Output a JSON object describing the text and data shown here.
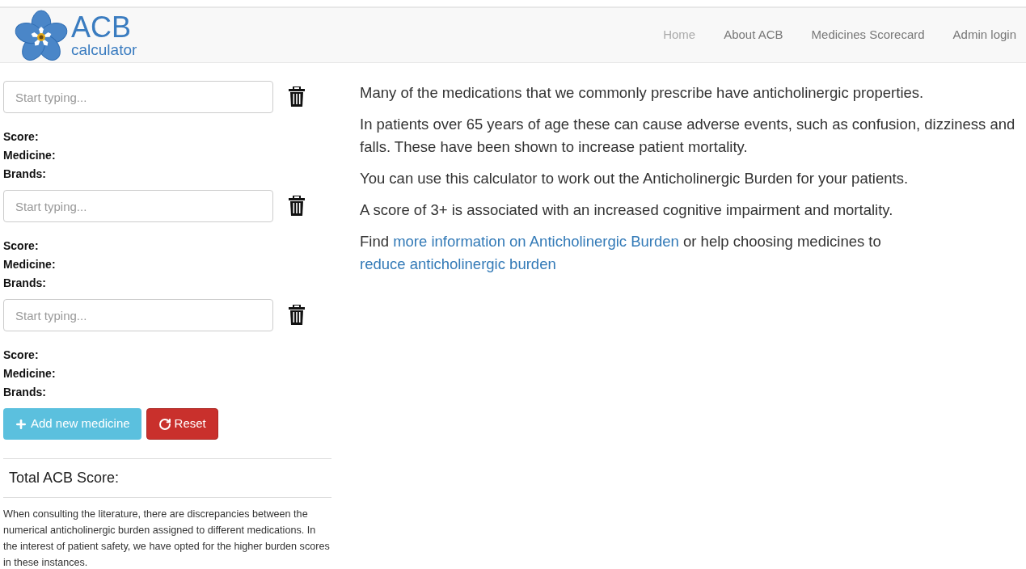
{
  "brand": {
    "title": "ACB",
    "subtitle": "calculator"
  },
  "nav": [
    {
      "label": "Home",
      "selected": true
    },
    {
      "label": "About ACB",
      "selected": false
    },
    {
      "label": "Medicines Scorecard",
      "selected": false
    },
    {
      "label": "Admin login",
      "selected": false
    }
  ],
  "medicines": [
    {
      "placeholder": "Start typing...",
      "fields": [
        "Score:",
        "Medicine:",
        "Brands:"
      ]
    },
    {
      "placeholder": "Start typing...",
      "fields": [
        "Score:",
        "Medicine:",
        "Brands:"
      ]
    },
    {
      "placeholder": "Start typing...",
      "fields": [
        "Score:",
        "Medicine:",
        "Brands:"
      ]
    }
  ],
  "buttons": {
    "add": "Add new medicine",
    "reset": "Reset"
  },
  "total_label": "Total ACB Score:",
  "note": "When consulting the literature, there are discrepancies between the numerical anticholinergic burden assigned to different medications. In the interest of patient safety, we have opted for the higher burden scores in these instances.",
  "intro": [
    "Many of the medications that we commonly prescribe have anticholinergic properties.",
    "In patients over 65 years of age these can cause adverse events, such as confusion, dizziness and falls. These have been shown to increase patient mortality.",
    "You can use this calculator to work out the Anticholinergic Burden for your patients.",
    "A score of 3+ is associated with an increased cognitive impairment and mortality."
  ],
  "links_paragraph": [
    {
      "kind": "text",
      "text": "Find "
    },
    {
      "kind": "link",
      "text": "more information on Anticholinergic Burden"
    },
    {
      "kind": "text",
      "text": " or help choosing medicines to "
    },
    {
      "kind": "link",
      "text": "reduce anticholinergic burden"
    }
  ]
}
